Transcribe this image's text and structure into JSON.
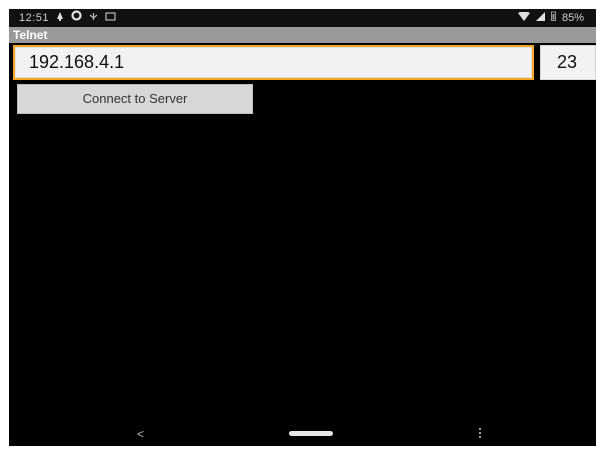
{
  "statusbar": {
    "time": "12:51",
    "battery": "85%",
    "icons_left": [
      "notification-icon",
      "sync-icon",
      "usb-icon",
      "screen-icon"
    ],
    "icons_right": [
      "wifi-icon",
      "signal-icon",
      "battery-icon"
    ]
  },
  "app": {
    "title": "Telnet"
  },
  "connection": {
    "host_value": "192.168.4.1",
    "port_value": "23",
    "connect_label": "Connect to Server"
  },
  "navbar": {
    "back_glyph": "<"
  },
  "colors": {
    "background": "#000000",
    "titlebar": "#9a9a9a",
    "input_focus_border": "#f5a623",
    "button": "#d7d7d7"
  }
}
